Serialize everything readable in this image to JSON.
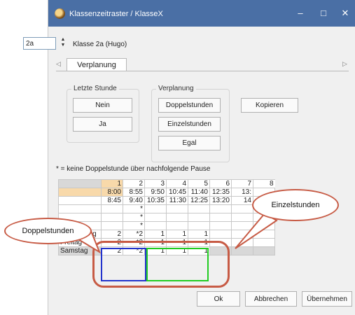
{
  "window": {
    "title": "Klassenzeitraster / KlasseX",
    "minimize": "–",
    "maximize": "□",
    "close": "✕"
  },
  "class_selector": {
    "value": "2a",
    "label": "Klasse 2a (Hugo)"
  },
  "tab_strip": {
    "left_arrow": "◁",
    "right_arrow": "▷",
    "tabs": [
      {
        "label": "Verplanung"
      }
    ]
  },
  "groups": {
    "letzte_stunde": {
      "label": "Letzte Stunde",
      "buttons": [
        "Nein",
        "Ja"
      ]
    },
    "verplanung": {
      "label": "Verplanung",
      "buttons": [
        "Doppelstunden",
        "Einzelstunden",
        "Egal"
      ]
    },
    "kopieren_label": "Kopieren"
  },
  "note": "* = keine Doppelstunde über nachfolgende Pause",
  "grid": {
    "columns": [
      "1",
      "2",
      "3",
      "4",
      "5",
      "6",
      "7",
      "8"
    ],
    "start_times": [
      "8:00",
      "8:55",
      "9:50",
      "10:45",
      "11:40",
      "12:35",
      "13:"
    ],
    "end_times": [
      "8:45",
      "9:40",
      "10:35",
      "11:30",
      "12:25",
      "13:20",
      "14"
    ],
    "rows": [
      {
        "label": "",
        "cells": [
          "",
          "*",
          "",
          "",
          "",
          "",
          "",
          ""
        ]
      },
      {
        "label": "",
        "cells": [
          "",
          "*",
          "",
          "",
          "",
          "",
          "",
          ""
        ]
      },
      {
        "label": "",
        "cells": [
          "",
          "*",
          "",
          "",
          "",
          "",
          "",
          ""
        ]
      },
      {
        "label": "Donnerstag",
        "cells": [
          "2",
          "*2",
          "1",
          "1",
          "1",
          "",
          "",
          ""
        ]
      },
      {
        "label": "Freitag",
        "cells": [
          "2",
          "*2",
          "1",
          "1",
          "1",
          "",
          "",
          ""
        ]
      },
      {
        "label": "Samstag",
        "cells": [
          "2",
          "*2",
          "1",
          "1",
          "1",
          "",
          "",
          ""
        ]
      }
    ]
  },
  "callouts": {
    "doppelstunden": "Doppelstunden",
    "einzelstunden": "Einzelstunden"
  },
  "buttons": {
    "ok": "Ok",
    "cancel": "Abbrechen",
    "apply": "Übernehmen"
  },
  "colors": {
    "titlebar": "#4a6fa5",
    "highlight_column": "#f8d9aa",
    "doppel_outline": "#2233cc",
    "einzel_outline": "#22cc22",
    "annotation_red": "#c75b45"
  }
}
